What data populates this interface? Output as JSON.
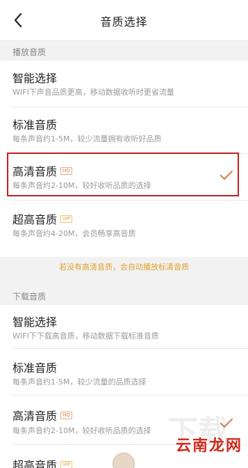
{
  "header": {
    "title": "音质选择"
  },
  "play_section": {
    "label": "播放音质",
    "items": [
      {
        "title": "智能选择",
        "subtitle": "WIFI下声音品质更高，移动数据收听时更省流量",
        "badge": ""
      },
      {
        "title": "标准音质",
        "subtitle": "每条声音约1-5M，较少流量拥有收听好品质",
        "badge": ""
      },
      {
        "title": "高清音质",
        "subtitle": "每条声音约2-10M，较好收听品质的选择",
        "badge": "HQ",
        "selected": true
      },
      {
        "title": "超高音质",
        "subtitle": "每条声音约4-20M，会员畅享高音质",
        "badge": "VIP"
      }
    ]
  },
  "notice": "若没有高清音质，会自动播放标清音质",
  "download_section": {
    "label": "下载音质",
    "items": [
      {
        "title": "智能选择",
        "subtitle": "WIFI下下载高音质，移动数据下载标准音质",
        "badge": ""
      },
      {
        "title": "标准音质",
        "subtitle": "每条声音约1-5M，较少流量的品质选择",
        "badge": ""
      },
      {
        "title": "高清音质",
        "subtitle": "每条声音约2-10M，较好收听品质的选择",
        "badge": "HQ",
        "selected": true
      },
      {
        "title": "超高音质",
        "subtitle": "",
        "badge": "VIP"
      }
    ]
  },
  "watermark": "云南龙网",
  "colors": {
    "accent": "#e0a12b",
    "check": "#d57a4a",
    "highlight": "#c0201f"
  },
  "icons": {
    "back": "chevron-left-icon",
    "selected": "check-icon"
  }
}
